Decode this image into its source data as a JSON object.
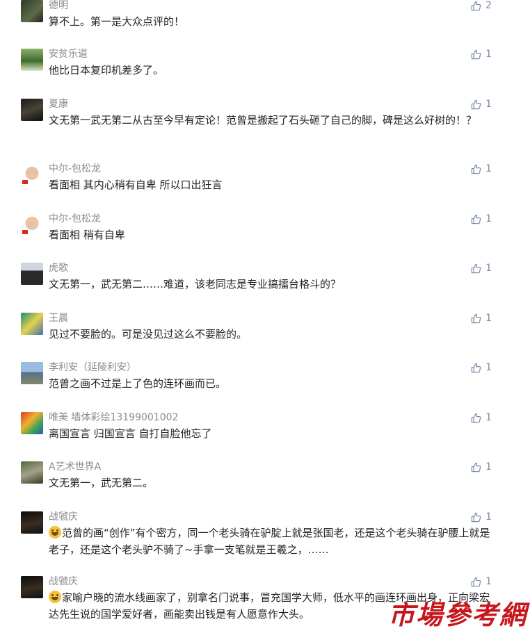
{
  "comments": [
    {
      "name": "德明",
      "text": "算不上。第一是大众点评的！",
      "likes": "2",
      "avatar": "dark-green"
    },
    {
      "name": "安贫乐道",
      "text": "他比日本复印机差多了。",
      "likes": "1",
      "avatar": "green-landscape"
    },
    {
      "name": "夏康",
      "text": "文无第一武无第二从古至今早有定论！范曾是搬起了石头砸了自己的脚，碑是这么好树的！？",
      "likes": "1",
      "avatar": "dark-portrait"
    },
    {
      "name": "中尔-包松龙",
      "text": "看面相 其内心稍有自卑 所以口出狂言",
      "likes": "1",
      "avatar": "face-flag"
    },
    {
      "name": "中尔-包松龙",
      "text": "看面相 稍有自卑",
      "likes": "1",
      "avatar": "face-flag"
    },
    {
      "name": "虎歌",
      "text": "文无第一，武无第二……难道，该老同志是专业搞擂台格斗的？",
      "likes": "1",
      "avatar": "man-suit"
    },
    {
      "name": "王晨",
      "text": "见过不要脸的。可是没见过这么不要脸的。",
      "likes": "1",
      "avatar": "teal-art"
    },
    {
      "name": "李利安（延陵利安）",
      "text": "范曾之画不过是上了色的连环画而已。",
      "likes": "1",
      "avatar": "building-sky"
    },
    {
      "name": "唯美 墙体彩绘13199001002",
      "text": "离国宣言  归国宣言 自打自脸他忘了",
      "likes": "1",
      "avatar": "colorful"
    },
    {
      "name": "A艺术世界A",
      "text": "文无第一，武无第二。",
      "likes": "1",
      "avatar": "path-trees"
    },
    {
      "name": "战虢庆",
      "text": "范曾的画“创作”有个密方，同一个老头骑在驴腚上就是张国老，还是这个老头骑在驴腰上就是老子，还是这个老头驴不骑了~手拿一支笔就是王羲之，……",
      "likes": "1",
      "avatar": "dark-portrait-2",
      "emoji": true
    },
    {
      "name": "战虢庆",
      "text": "家喻户晓的流水线画家了，别拿名门说事，冒充国学大师，低水平的画连环画出身，正向梁宏达先生说的国学爱好者，画能卖出钱是有人愿意作大头。",
      "likes": "1",
      "avatar": "dark-portrait-2",
      "emoji": true
    }
  ],
  "watermark": "市場參考網",
  "colors": {
    "name": "#8a8a8a",
    "like": "#7a8aa6",
    "text": "#222222",
    "watermark": "#c8161d"
  }
}
